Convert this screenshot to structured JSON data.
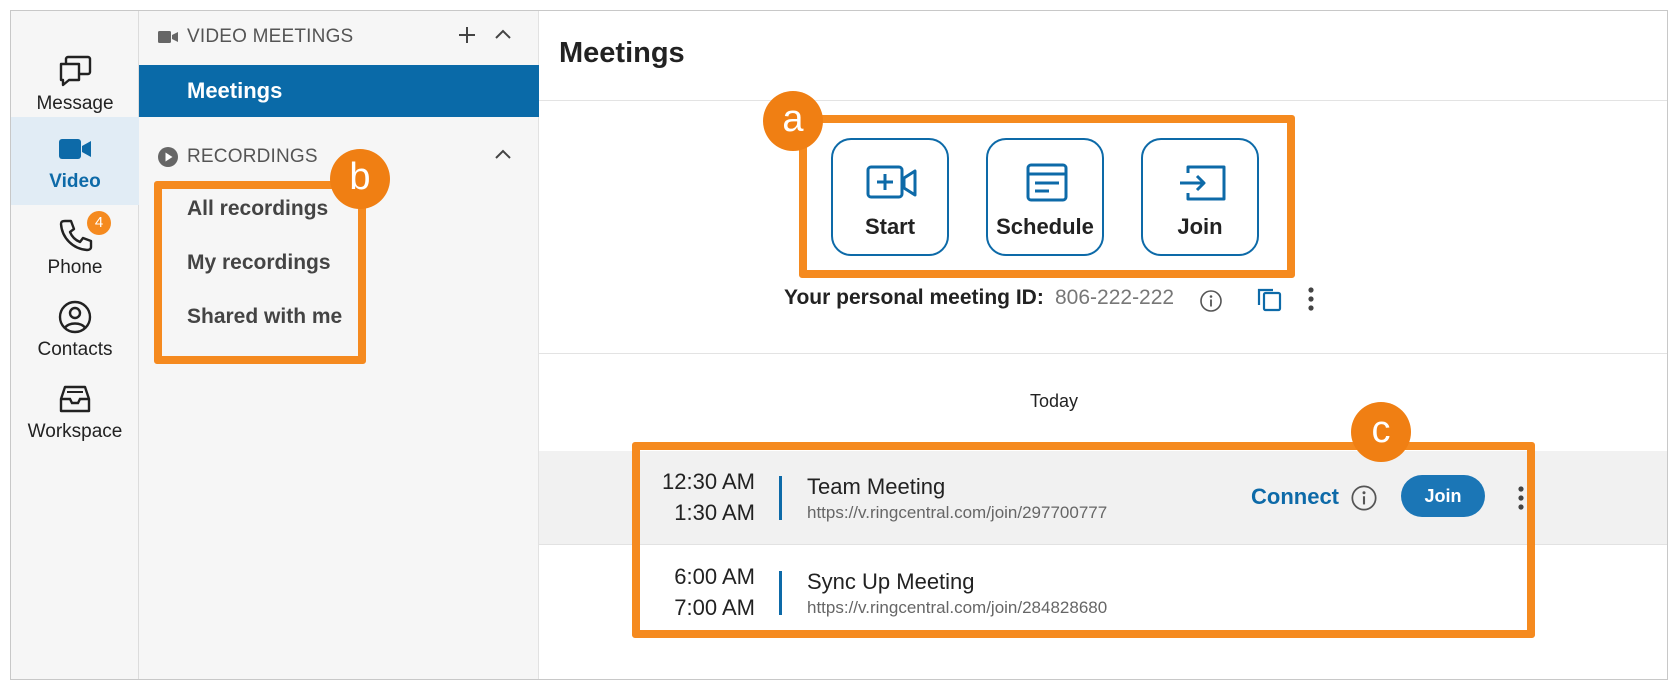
{
  "rail": {
    "items": [
      {
        "label": "Message",
        "icon": "message-icon"
      },
      {
        "label": "Video",
        "icon": "video-icon",
        "active": true
      },
      {
        "label": "Phone",
        "icon": "phone-icon",
        "badge": "4"
      },
      {
        "label": "Contacts",
        "icon": "contacts-icon"
      },
      {
        "label": "Workspace",
        "icon": "workspace-icon"
      }
    ]
  },
  "sidebar": {
    "video_meetings_title": "VIDEO MEETINGS",
    "meetings_label": "Meetings",
    "recordings_title": "RECORDINGS",
    "recordings": [
      "All recordings",
      "My recordings",
      "Shared with me"
    ]
  },
  "main": {
    "title": "Meetings",
    "actions": [
      {
        "label": "Start",
        "icon": "video-plus-icon"
      },
      {
        "label": "Schedule",
        "icon": "calendar-icon"
      },
      {
        "label": "Join",
        "icon": "join-arrow-icon"
      }
    ],
    "personal_id_label": "Your personal meeting ID:",
    "personal_id_value": "806-222-222",
    "today_label": "Today",
    "meetings": [
      {
        "start": "12:30 AM",
        "end": "1:30 AM",
        "title": "Team Meeting",
        "url": "https://v.ringcentral.com/join/297700777",
        "connect_label": "Connect",
        "join_label": "Join"
      },
      {
        "start": "6:00 AM",
        "end": "7:00 AM",
        "title": "Sync Up Meeting",
        "url": "https://v.ringcentral.com/join/284828680"
      }
    ]
  },
  "callouts": [
    "a",
    "b",
    "c"
  ],
  "colors": {
    "accent": "#0d6aa8",
    "callout": "#f58a1f",
    "badge": "#f58a1f"
  }
}
